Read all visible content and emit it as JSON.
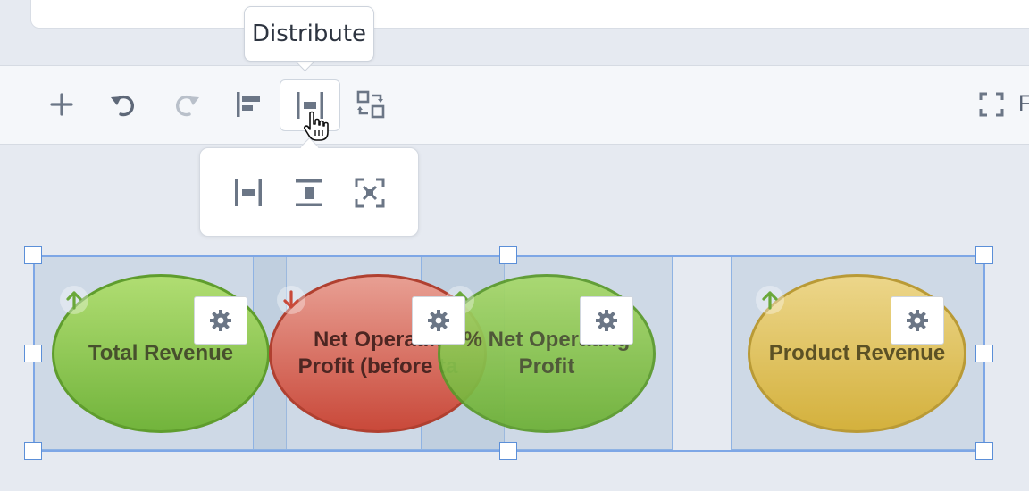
{
  "tooltip": {
    "text": "Distribute"
  },
  "toolbar": {
    "buttons": [
      {
        "name": "add-icon"
      },
      {
        "name": "undo-icon"
      },
      {
        "name": "redo-icon",
        "disabled": true
      },
      {
        "name": "align-left-icon"
      },
      {
        "name": "distribute-icon",
        "active": true
      },
      {
        "name": "swap-icon"
      },
      {
        "name": "fullscreen-icon"
      }
    ],
    "frame_label": "F"
  },
  "distribute_menu": [
    {
      "name": "distribute-horizontal-icon"
    },
    {
      "name": "distribute-vertical-icon"
    },
    {
      "name": "distribute-spread-icon"
    }
  ],
  "widgets": [
    {
      "label": "Total Revenue",
      "trend": "up",
      "color": "#8cc652"
    },
    {
      "label": "Net Operatin\nProfit (before ta",
      "trend": "down",
      "color": "#d56b5f"
    },
    {
      "label": "% Net Operating\nProfit",
      "trend": "up",
      "color": "#84c447"
    },
    {
      "label": "Product Revenue",
      "trend": "up",
      "color": "#e2c25c"
    }
  ],
  "colors": {
    "trend_up": "#6aa83a",
    "trend_down": "#c94a3a",
    "icon": "#6b7686"
  }
}
